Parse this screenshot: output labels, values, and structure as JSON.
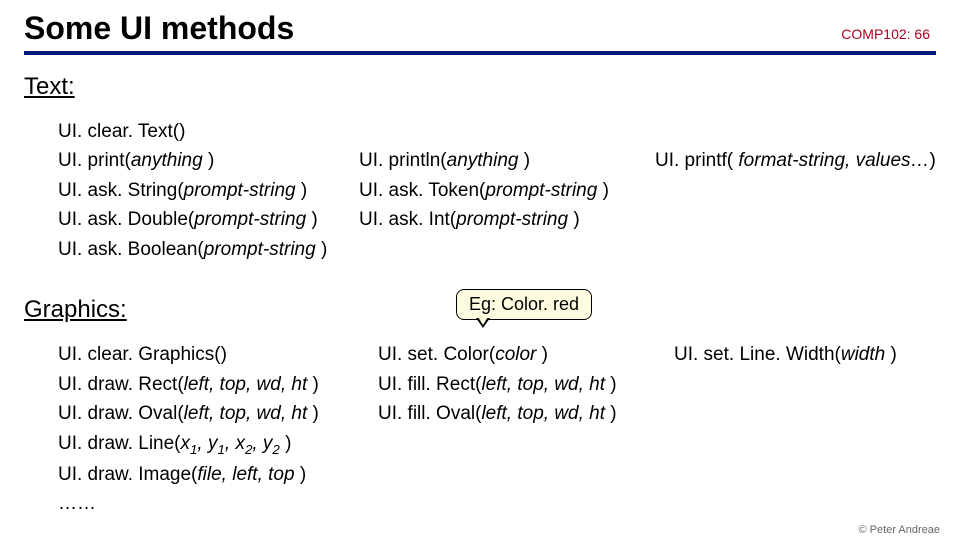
{
  "header": {
    "title": "Some UI methods",
    "slidenum": "COMP102: 66"
  },
  "text": {
    "heading": "Text:",
    "r0": "UI. clear. Text()",
    "r1a_pre": "UI. print(",
    "r1a_i": "anything",
    "r1a_post": " )",
    "r1b_pre": "UI. println(",
    "r1b_i": "anything",
    "r1b_post": " )",
    "r1c_pre": "UI. printf( ",
    "r1c_i": "format-string, values…",
    "r1c_post": ")",
    "r2a_pre": "UI. ask. String(",
    "r2a_i": "prompt-string",
    "r2a_post": " )",
    "r2b_pre": "UI. ask. Token(",
    "r2b_i": "prompt-string",
    "r2b_post": " )",
    "r3a_pre": "UI. ask. Double(",
    "r3a_i": "prompt-string",
    "r3a_post": " )",
    "r3b_pre": "UI. ask. Int(",
    "r3b_i": "prompt-string",
    "r3b_post": " )",
    "r4a_pre": "UI. ask. Boolean(",
    "r4a_i": "prompt-string",
    "r4a_post": " )"
  },
  "graphics": {
    "heading": "Graphics:",
    "callout": "Eg:  Color. red",
    "r0a": "UI. clear. Graphics()",
    "r0b_pre": "UI. set. Color(",
    "r0b_i": "color",
    "r0b_post": " )",
    "r0c_pre": "UI. set. Line. Width(",
    "r0c_i": "width",
    "r0c_post": " )",
    "r1a_pre": "UI. draw. Rect(",
    "r1a_i": "left, top, wd, ht",
    "r1a_post": " )",
    "r1b_pre": "UI. fill. Rect(",
    "r1b_i": "left, top, wd, ht",
    "r1b_post": " )",
    "r2a_pre": "UI. draw. Oval(",
    "r2a_i": "left, top, wd, ht",
    "r2a_post": " )",
    "r2b_pre": "UI. fill. Oval(",
    "r2b_i": "left, top, wd, ht",
    "r2b_post": " )",
    "r3_pre": "UI. draw. Line(",
    "r3_x1": "x",
    "r3_s1": "1",
    "r3_c1": ", ",
    "r3_y1": "y",
    "r3_s2": "1",
    "r3_c2": ", ",
    "r3_x2": "x",
    "r3_s3": "2",
    "r3_c3": ", ",
    "r3_y2": "y",
    "r3_s4": "2",
    "r3_post": " )",
    "r4_pre": "UI. draw. Image(",
    "r4_i": "file, left, top",
    "r4_post": " )",
    "ellipsis": "……"
  },
  "footer": {
    "copyright": "© Peter Andreae"
  }
}
